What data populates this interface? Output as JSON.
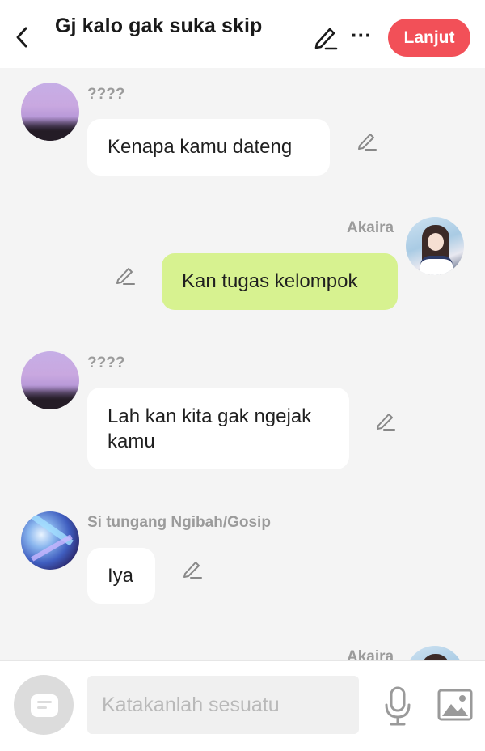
{
  "header": {
    "title": "Gj kalo gak suka skip",
    "next_label": "Lanjut",
    "more_label": "···"
  },
  "messages": [
    {
      "sender": "????",
      "text": "Kenapa kamu dateng",
      "own": false,
      "avatar": "sky-avatar"
    },
    {
      "sender": "Akaira",
      "text": "Kan tugas kelompok",
      "own": true,
      "avatar": "girl-avatar"
    },
    {
      "sender": "????",
      "text": "Lah kan kita gak ngejak kamu",
      "own": false,
      "avatar": "sky-avatar"
    },
    {
      "sender": "Si tungang Ngibah/Gosip",
      "text": "Iya",
      "own": false,
      "avatar": "anime-avatar"
    },
    {
      "sender": "Akaira",
      "text": "",
      "own": true,
      "avatar": "girl-avatar"
    }
  ],
  "composer": {
    "placeholder": "Katakanlah sesuatu"
  },
  "colors": {
    "accent": "#f25058",
    "own_bubble": "#d7f290",
    "other_bubble": "#ffffff",
    "background": "#f4f4f4"
  },
  "icons": [
    "back-arrow-icon",
    "edit-icon",
    "more-icon",
    "pencil-icon",
    "chat-menu-icon",
    "microphone-icon",
    "image-icon"
  ]
}
